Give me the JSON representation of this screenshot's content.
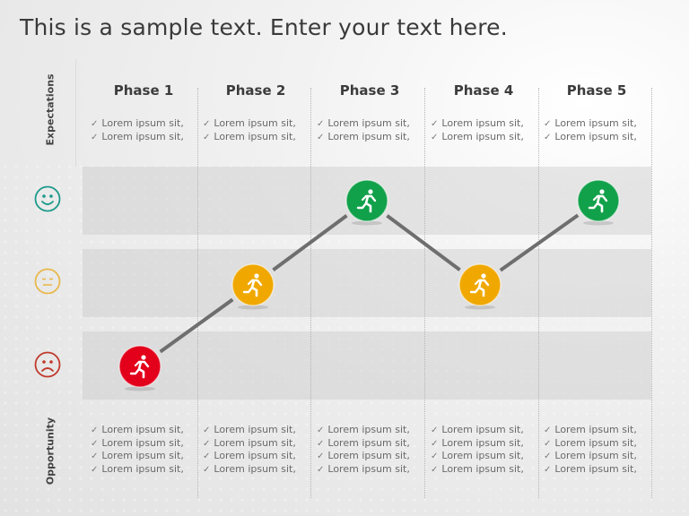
{
  "title": "This is a sample text. Enter your text here.",
  "side_labels": {
    "top": "Expectations",
    "bottom": "Opportunity"
  },
  "faces": [
    {
      "name": "happy-face-icon",
      "mood": "happy",
      "color": "#1a9a8a"
    },
    {
      "name": "neutral-face-icon",
      "mood": "neutral",
      "color": "#e8b84a"
    },
    {
      "name": "sad-face-icon",
      "mood": "sad",
      "color": "#c0392b"
    }
  ],
  "phases": [
    {
      "label": "Phase 1",
      "expectations": [
        "Lorem ipsum sit,",
        "Lorem ipsum sit,"
      ],
      "opportunity": [
        "Lorem ipsum sit,",
        "Lorem ipsum sit,",
        "Lorem ipsum sit,",
        "Lorem ipsum sit,"
      ]
    },
    {
      "label": "Phase 2",
      "expectations": [
        "Lorem ipsum sit,",
        "Lorem ipsum sit,"
      ],
      "opportunity": [
        "Lorem ipsum sit,",
        "Lorem ipsum sit,",
        "Lorem ipsum sit,",
        "Lorem ipsum sit,"
      ]
    },
    {
      "label": "Phase 3",
      "expectations": [
        "Lorem ipsum sit,",
        "Lorem ipsum sit,"
      ],
      "opportunity": [
        "Lorem ipsum sit,",
        "Lorem ipsum sit,",
        "Lorem ipsum sit,",
        "Lorem ipsum sit,"
      ]
    },
    {
      "label": "Phase 4",
      "expectations": [
        "Lorem ipsum sit,",
        "Lorem ipsum sit,"
      ],
      "opportunity": [
        "Lorem ipsum sit,",
        "Lorem ipsum sit,",
        "Lorem ipsum sit,",
        "Lorem ipsum sit,"
      ]
    },
    {
      "label": "Phase 5",
      "expectations": [
        "Lorem ipsum sit,",
        "Lorem ipsum sit,"
      ],
      "opportunity": [
        "Lorem ipsum sit,",
        "Lorem ipsum sit,",
        "Lorem ipsum sit,",
        "Lorem ipsum sit,"
      ]
    }
  ],
  "check_glyph": "✓",
  "journey": {
    "levels": [
      "sad",
      "neutral",
      "happy"
    ],
    "points": [
      {
        "phase": "Phase 1",
        "level": "sad",
        "color": "#e3001b"
      },
      {
        "phase": "Phase 2",
        "level": "neutral",
        "color": "#f0a800"
      },
      {
        "phase": "Phase 3",
        "level": "happy",
        "color": "#12a14b"
      },
      {
        "phase": "Phase 4",
        "level": "neutral",
        "color": "#f0a800"
      },
      {
        "phase": "Phase 5",
        "level": "happy",
        "color": "#12a14b"
      }
    ],
    "line_color": "#6e6e6e",
    "marker_icon": "runner-icon"
  }
}
